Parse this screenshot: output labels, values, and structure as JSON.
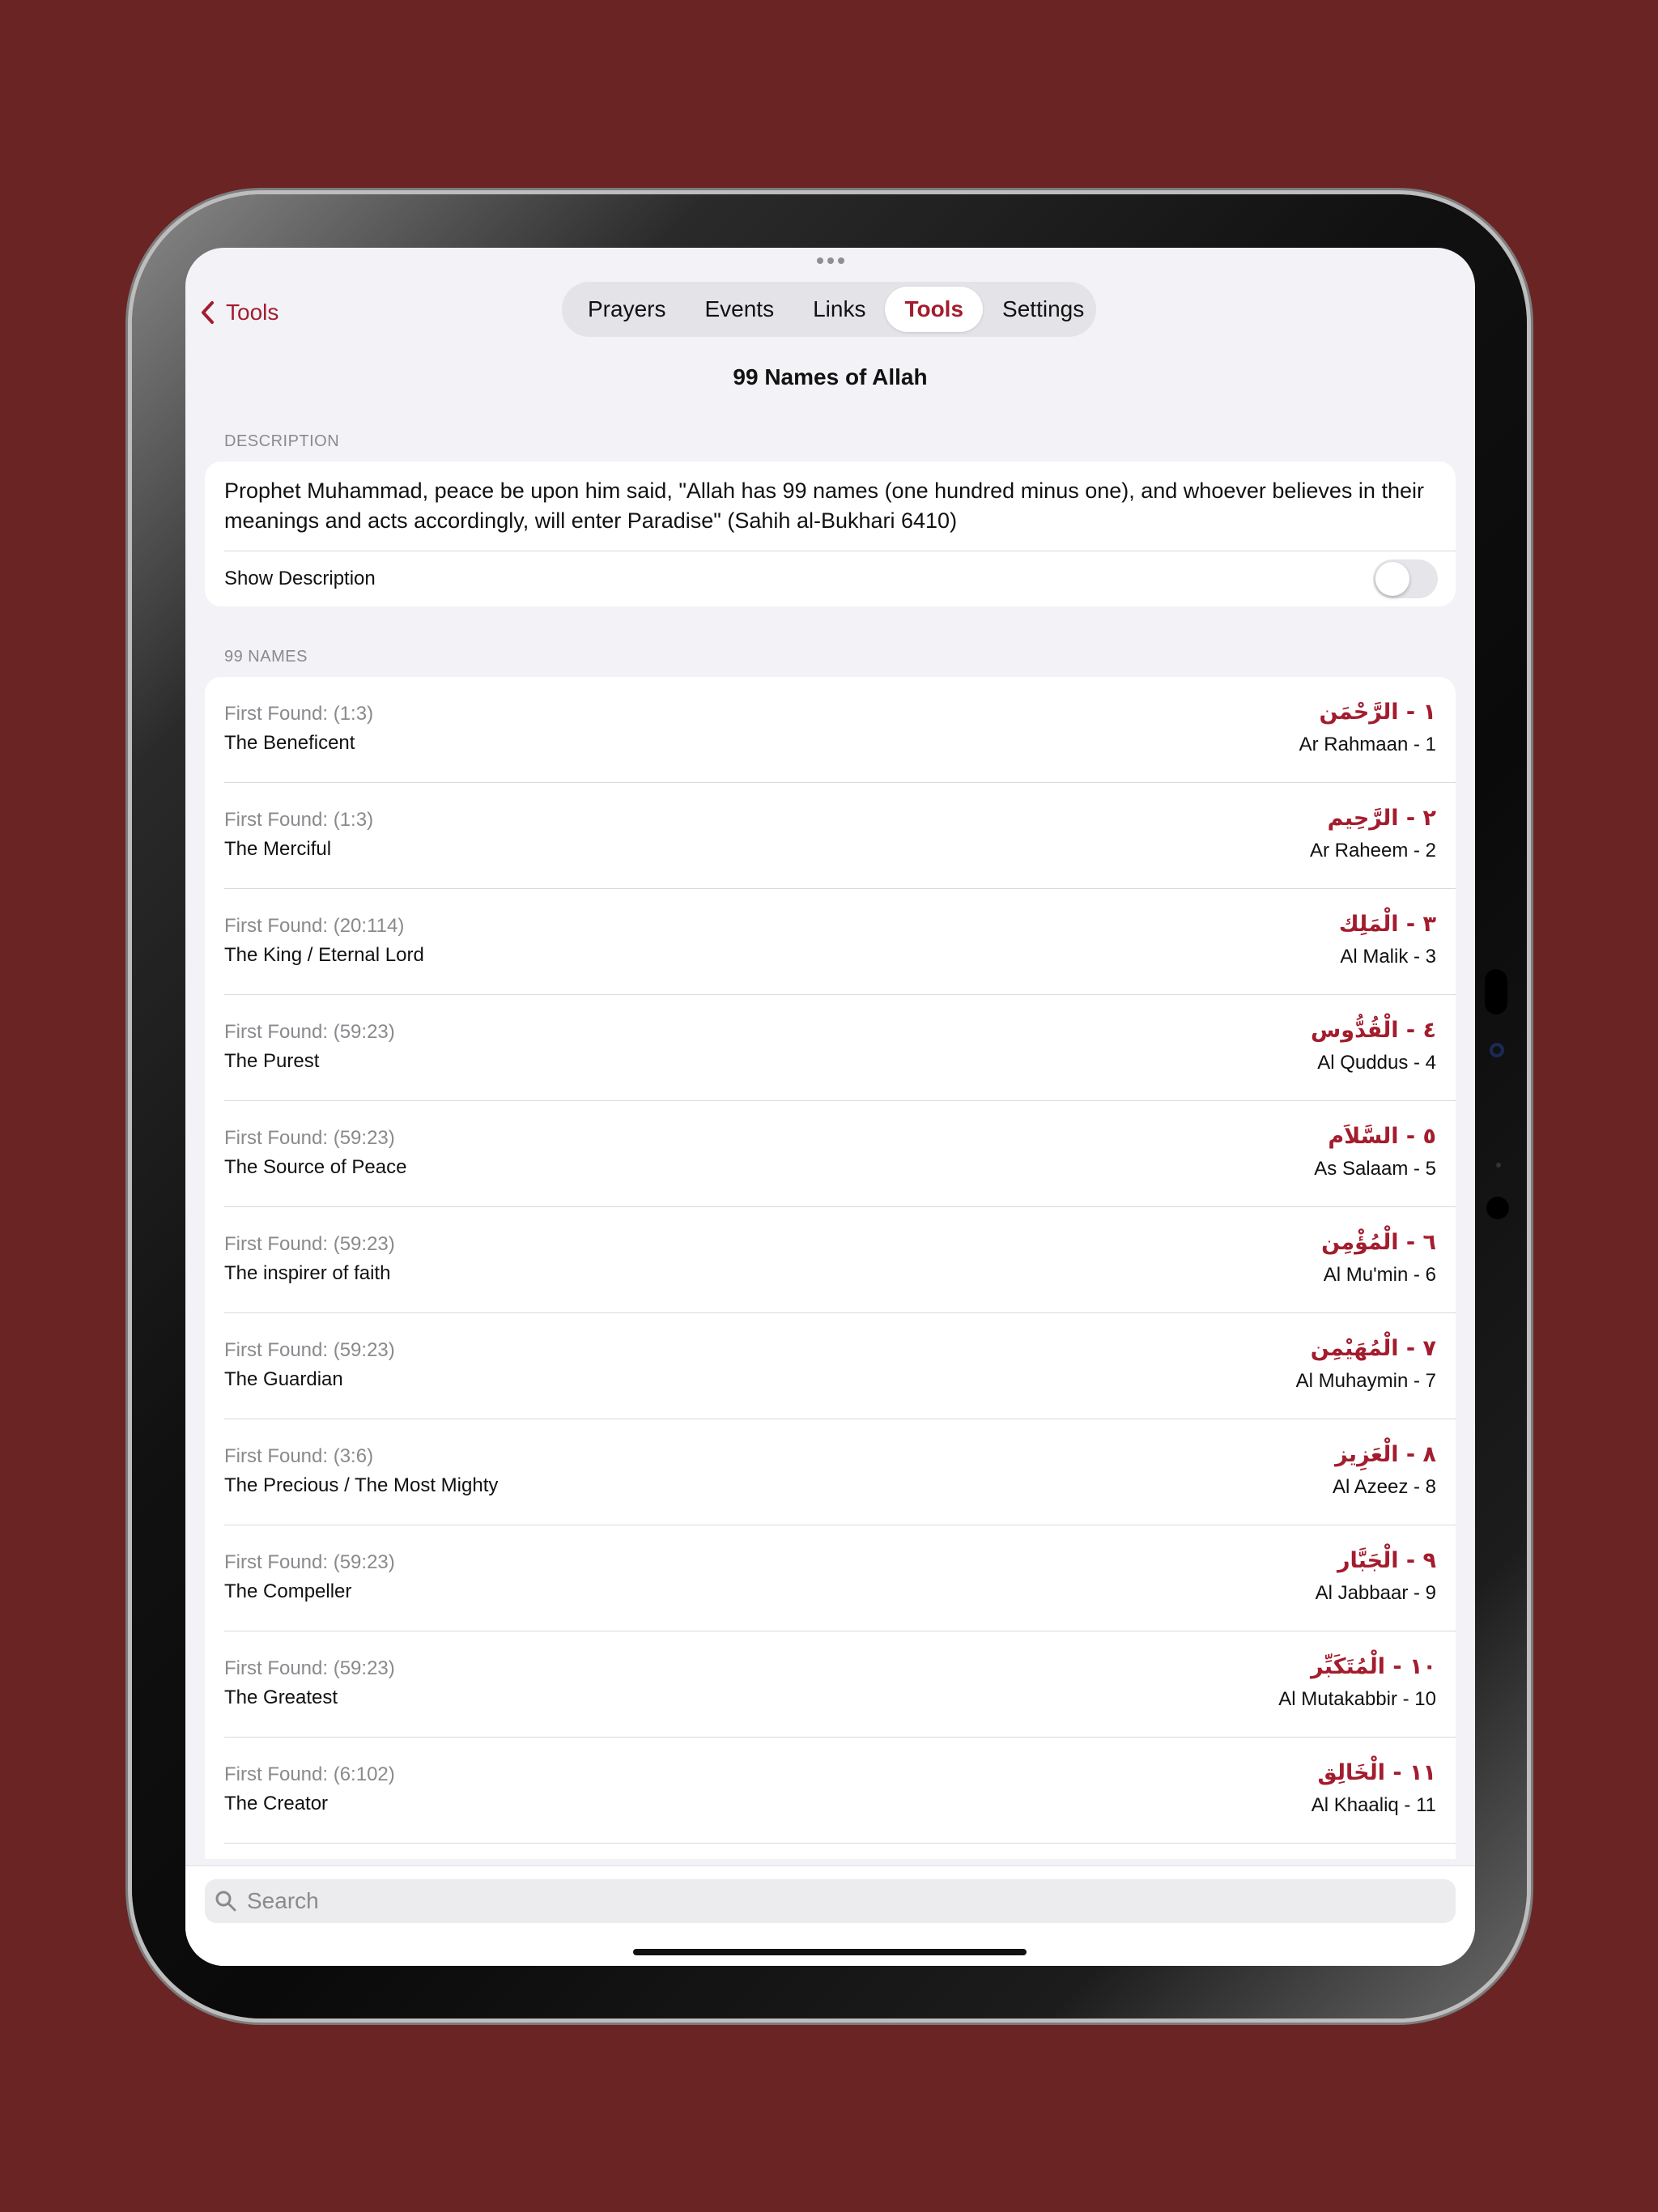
{
  "nav": {
    "back_label": "Tools",
    "tabs": [
      {
        "label": "Prayers",
        "active": false
      },
      {
        "label": "Events",
        "active": false
      },
      {
        "label": "Links",
        "active": false
      },
      {
        "label": "Tools",
        "active": true
      },
      {
        "label": "Settings",
        "active": false
      }
    ],
    "title": "99 Names of Allah"
  },
  "description": {
    "header": "DESCRIPTION",
    "text": "Prophet Muhammad, peace be upon him said, \"Allah has 99 names (one hundred minus one), and whoever believes in their meanings and acts accordingly, will enter Paradise\" (Sahih al-Bukhari 6410)",
    "toggle_label": "Show Description",
    "toggle_on": false
  },
  "names": {
    "header": "99 NAMES",
    "items": [
      {
        "found": "First Found: (1:3)",
        "meaning": "The Beneficent",
        "arabic": "١ - الرَّحْمَن",
        "translit": "Ar Rahmaan - 1"
      },
      {
        "found": "First Found: (1:3)",
        "meaning": "The Merciful",
        "arabic": "٢ - الرَّحِيم",
        "translit": "Ar Raheem - 2"
      },
      {
        "found": "First Found: (20:114)",
        "meaning": "The King / Eternal Lord",
        "arabic": "٣ - الْمَلِك",
        "translit": "Al Malik - 3"
      },
      {
        "found": "First Found: (59:23)",
        "meaning": "The Purest",
        "arabic": "٤ - الْقُدُّوس",
        "translit": "Al Quddus - 4"
      },
      {
        "found": "First Found: (59:23)",
        "meaning": "The Source of Peace",
        "arabic": "٥ - السَّلاَم",
        "translit": "As Salaam - 5"
      },
      {
        "found": "First Found: (59:23)",
        "meaning": "The inspirer of faith",
        "arabic": "٦ - الْمُؤْمِن",
        "translit": "Al Mu'min - 6"
      },
      {
        "found": "First Found: (59:23)",
        "meaning": "The Guardian",
        "arabic": "٧ - الْمُهَيْمِن",
        "translit": "Al Muhaymin - 7"
      },
      {
        "found": "First Found: (3:6)",
        "meaning": "The Precious / The Most Mighty",
        "arabic": "٨ - الْعَزِيز",
        "translit": "Al Azeez - 8"
      },
      {
        "found": "First Found: (59:23)",
        "meaning": "The Compeller",
        "arabic": "٩ - الْجَبَّار",
        "translit": "Al Jabbaar - 9"
      },
      {
        "found": "First Found: (59:23)",
        "meaning": "The Greatest",
        "arabic": "١٠ - الْمُتَكَبِّر",
        "translit": "Al Mutakabbir - 10"
      },
      {
        "found": "First Found: (6:102)",
        "meaning": "The Creator",
        "arabic": "١١ - الْخَالِق",
        "translit": "Al Khaaliq - 11"
      }
    ]
  },
  "search": {
    "placeholder": "Search"
  },
  "colors": {
    "accent": "#a31d2e",
    "background": "#6a2424",
    "screen": "#f2f2f7"
  },
  "icons": {
    "back": "chevron-left-icon",
    "search": "magnifying-glass-icon",
    "more": "ellipsis-icon"
  }
}
